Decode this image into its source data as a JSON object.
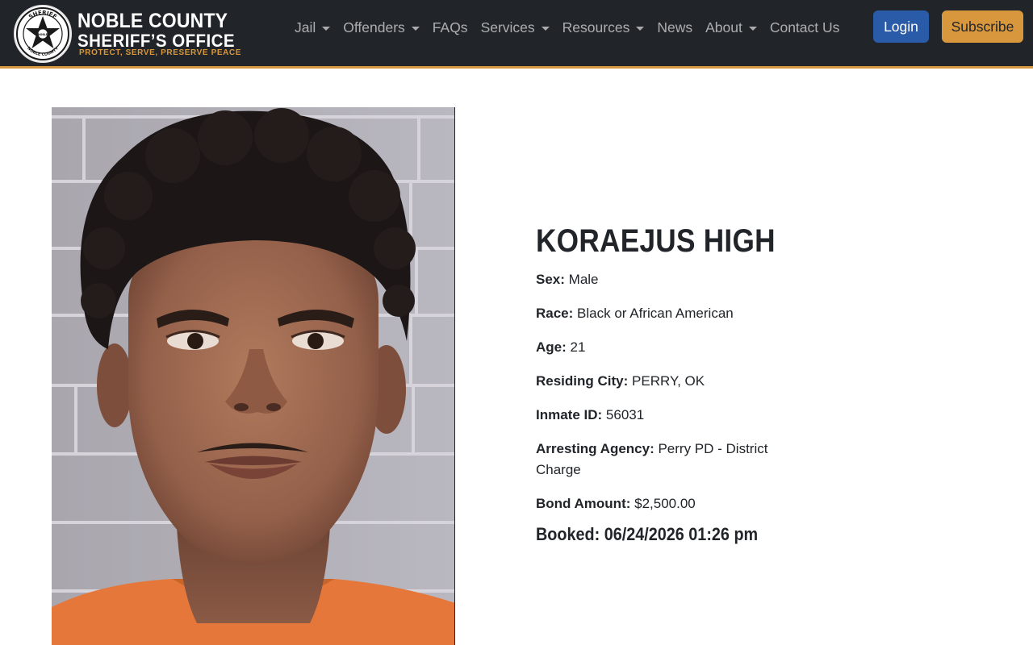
{
  "brand": {
    "line1": "NOBLE COUNTY",
    "line2": "SHERIFF’S OFFICE",
    "tagline": "PROTECT, SERVE, PRESERVE PEACE",
    "seal_top": "SHERIFF",
    "seal_center": "NOBLE",
    "seal_bottom": "NOBLE COUNTY"
  },
  "nav": {
    "items": [
      {
        "label": "Jail",
        "dropdown": true
      },
      {
        "label": "Offenders",
        "dropdown": true
      },
      {
        "label": "FAQs",
        "dropdown": false
      },
      {
        "label": "Services",
        "dropdown": true
      },
      {
        "label": "Resources",
        "dropdown": true
      },
      {
        "label": "News",
        "dropdown": false
      },
      {
        "label": "About",
        "dropdown": true
      },
      {
        "label": "Contact Us",
        "dropdown": false
      }
    ],
    "login_label": "Login",
    "subscribe_label": "Subscribe"
  },
  "inmate": {
    "name": "KORAEJUS HIGH",
    "fields": [
      {
        "label": "Sex:",
        "value": "Male"
      },
      {
        "label": "Race:",
        "value": "Black or African American"
      },
      {
        "label": "Age:",
        "value": "21"
      },
      {
        "label": "Residing City:",
        "value": "PERRY, OK"
      },
      {
        "label": "Inmate ID:",
        "value": "56031"
      },
      {
        "label": "Arresting Agency:",
        "value": "Perry PD - District Charge"
      },
      {
        "label": "Bond Amount:",
        "value": "$2,500.00"
      }
    ],
    "booked": "Booked: 06/24/2026 01:26 pm"
  },
  "colors": {
    "navbar_bg": "#212529",
    "accent_gold": "#d8973c",
    "login_blue": "#2a5ba8"
  }
}
